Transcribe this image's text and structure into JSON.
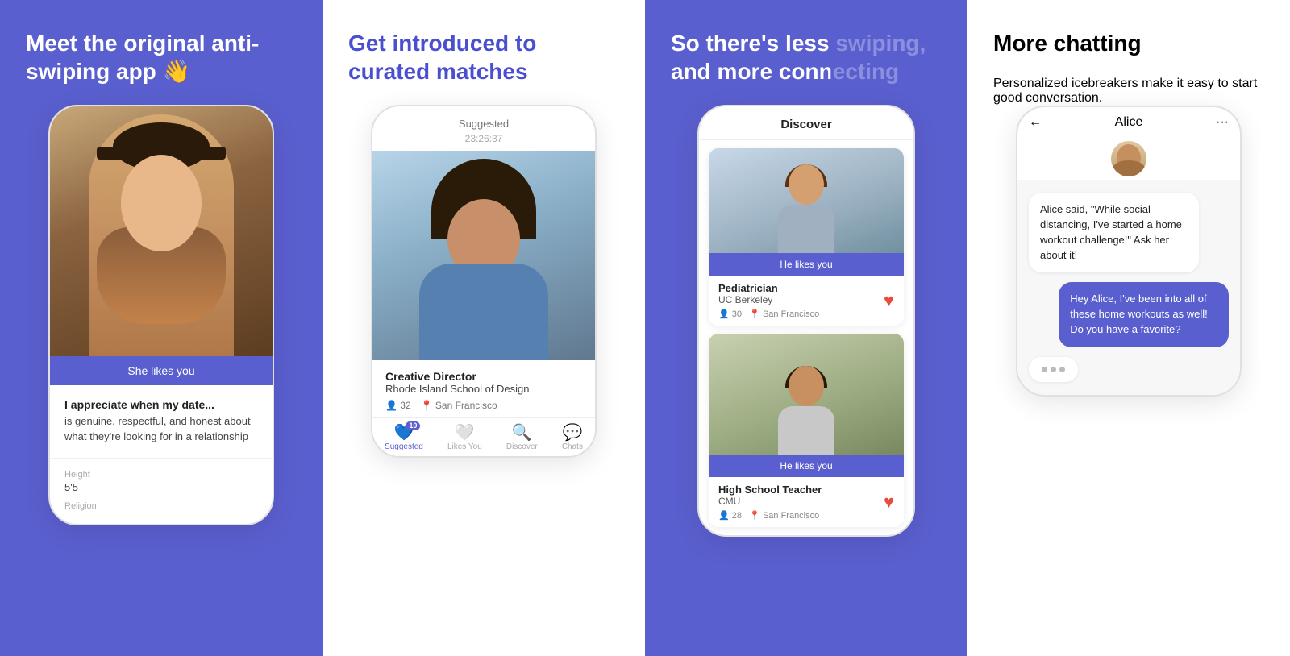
{
  "panels": [
    {
      "id": "panel1",
      "heading": "Meet the original anti-swiping app 👋",
      "likes_label": "She likes you",
      "prompt_question": "I appreciate when my date...",
      "prompt_answer": "is genuine, respectful, and honest about what they're looking for in a relationship",
      "attr1_label": "Height",
      "attr1_value": "5'5",
      "attr2_label": "Religion",
      "attr2_value": ""
    },
    {
      "id": "panel2",
      "heading": "Get introduced to curated matches",
      "suggested_label": "Suggested",
      "timer": "23:26:37",
      "job": "Creative Director",
      "school": "Rhode Island School of Design",
      "age": "32",
      "city": "San Francisco",
      "nav_suggested": "Suggested",
      "nav_likes": "Likes You",
      "nav_discover": "Discover",
      "nav_chats": "Chats",
      "badge_count": "10"
    },
    {
      "id": "panel3",
      "heading": "So there's less swiping, and more connecting",
      "discover_header": "Discover",
      "card1_likes": "He likes you",
      "card1_job": "Pediatrician",
      "card1_school": "UC Berkeley",
      "card1_age": "30",
      "card1_city": "San Francisco",
      "card2_likes": "He likes you",
      "card2_job": "High School Teacher",
      "card2_school": "CMU",
      "card2_age": "28",
      "card2_city": "San Francisco"
    },
    {
      "id": "panel4",
      "heading": "More chatting",
      "subheading": "Personalized icebreakers make it easy to start good conversation.",
      "chat_name": "Alice",
      "msg1": "Alice said, \"While social distancing, I've started a home workout challenge!\" Ask her about it!",
      "msg2": "Hey Alice, I've been into all of these home workouts as well! Do you have a favorite?"
    }
  ],
  "icons": {
    "back": "←",
    "more": "···",
    "heart": "♥",
    "person": "👤",
    "location": "📍",
    "chat": "💬",
    "discover": "🔍"
  }
}
